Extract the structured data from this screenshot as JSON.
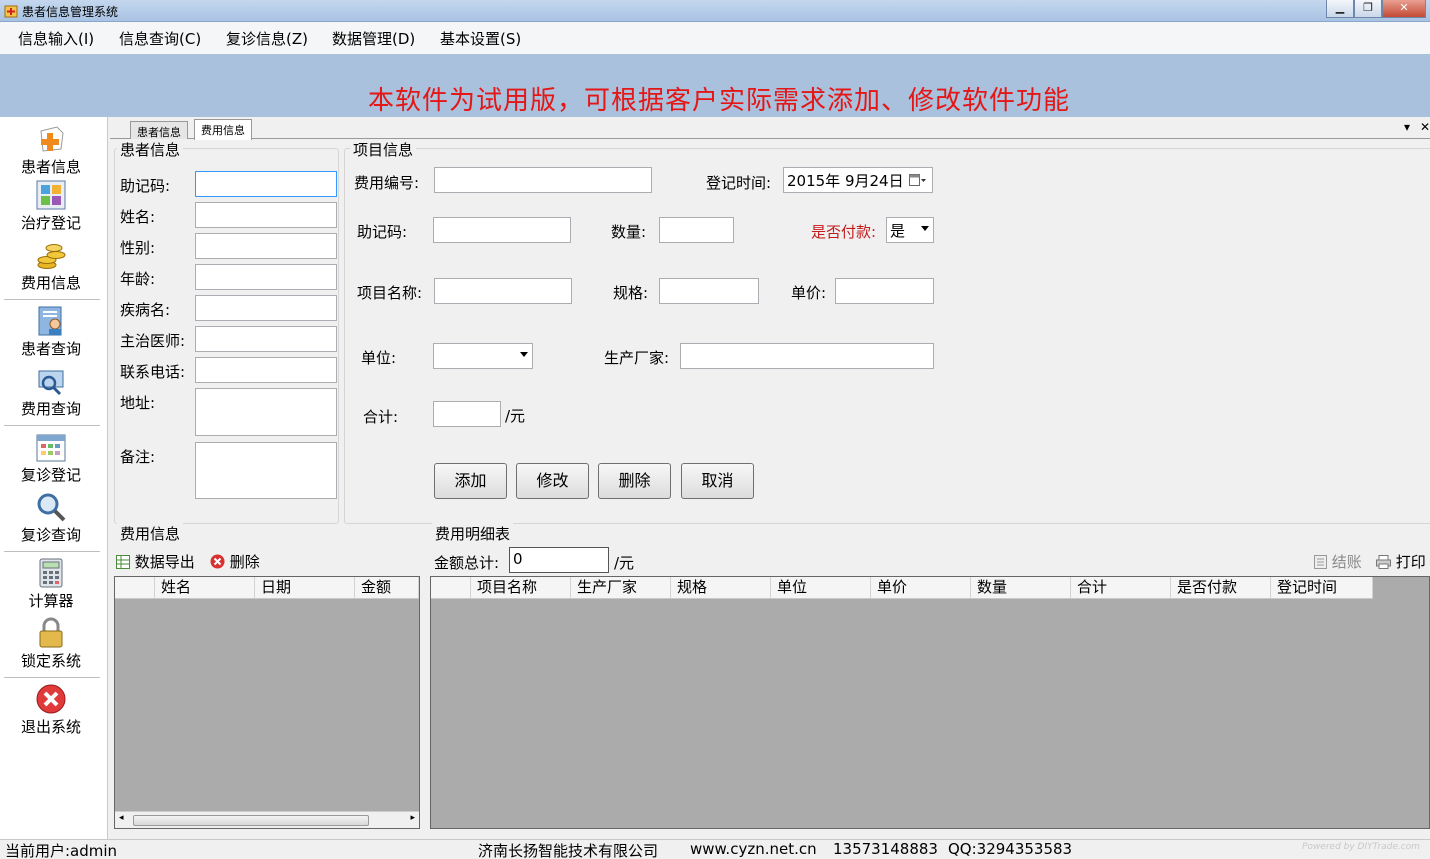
{
  "window": {
    "title": "患者信息管理系统",
    "minimize": "▁",
    "maximize": "❐",
    "close": "✕"
  },
  "menu": [
    "信息输入(I)",
    "信息查询(C)",
    "复诊信息(Z)",
    "数据管理(D)",
    "基本设置(S)"
  ],
  "banner": "本软件为试用版，可根据客户实际需求添加、修改软件功能",
  "nav": [
    {
      "label": "患者信息",
      "icon": "add-patient-icon"
    },
    {
      "label": "治疗登记",
      "icon": "treatment-register-icon"
    },
    {
      "label": "费用信息",
      "icon": "coins-icon"
    },
    {
      "label": "患者查询",
      "icon": "patient-search-icon"
    },
    {
      "label": "费用查询",
      "icon": "fee-search-icon"
    },
    {
      "label": "复诊登记",
      "icon": "calendar-icon"
    },
    {
      "label": "复诊查询",
      "icon": "magnifier-icon"
    },
    {
      "label": "计算器",
      "icon": "calculator-icon"
    },
    {
      "label": "锁定系统",
      "icon": "lock-icon"
    },
    {
      "label": "退出系统",
      "icon": "exit-icon"
    }
  ],
  "tabs": [
    "患者信息",
    "费用信息"
  ],
  "tab_controls": {
    "dropdown": "▾",
    "close": "✕"
  },
  "patient": {
    "title": "患者信息",
    "fields": {
      "code": "助记码:",
      "name": "姓名:",
      "gender": "性别:",
      "age": "年龄:",
      "disease": "疾病名:",
      "doctor": "主治医师:",
      "phone": "联系电话:",
      "address": "地址:",
      "remark": "备注:"
    }
  },
  "project": {
    "title": "项目信息",
    "fee_no_label": "费用编号:",
    "reg_time_label": "登记时间:",
    "reg_time_value": "2015年  9月24日",
    "code_label": "助记码:",
    "qty_label": "数量:",
    "paid_label": "是否付款:",
    "paid_value": "是",
    "item_name_label": "项目名称:",
    "spec_label": "规格:",
    "price_label": "单价:",
    "unit_label": "单位:",
    "maker_label": "生产厂家:",
    "total_label": "合计:",
    "total_unit": "/元",
    "buttons": {
      "add": "添加",
      "edit": "修改",
      "delete": "删除",
      "cancel": "取消"
    }
  },
  "fee_info": {
    "title": "费用信息",
    "export": "数据导出",
    "delete": "删除",
    "columns": [
      "姓名",
      "日期",
      "金额"
    ]
  },
  "fee_detail": {
    "title": "费用明细表",
    "sum_label": "金额总计:",
    "sum_value": "0",
    "sum_unit": "/元",
    "checkout": "结账",
    "print": "打印",
    "columns": [
      "项目名称",
      "生产厂家",
      "规格",
      "单位",
      "单价",
      "数量",
      "合计",
      "是否付款",
      "登记时间"
    ]
  },
  "status": {
    "user": "当前用户:admin",
    "company": "济南长扬智能技术有限公司",
    "website": "www.cyzn.net.cn",
    "phone": "13573148883",
    "qq": "QQ:3294353583",
    "watermark": "Powered by DIYTrade.com"
  }
}
